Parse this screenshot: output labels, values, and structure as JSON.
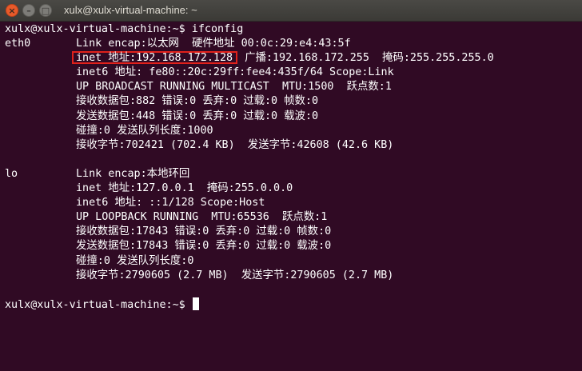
{
  "window": {
    "title": "xulx@xulx-virtual-machine: ~",
    "buttons": {
      "close": "×",
      "minimize": "–",
      "maximize": "□"
    }
  },
  "terminal": {
    "prompt1": "xulx@xulx-virtual-machine:~$ ifconfig",
    "eth0": {
      "name": "eth0",
      "l1": "Link encap:以太网  硬件地址 00:0c:29:e4:43:5f",
      "l2_inet": "inet 地址:192.168.172.128",
      "l2_rest": " 广播:192.168.172.255  掩码:255.255.255.0",
      "l3": "inet6 地址: fe80::20c:29ff:fee4:435f/64 Scope:Link",
      "l4": "UP BROADCAST RUNNING MULTICAST  MTU:1500  跃点数:1",
      "l5": "接收数据包:882 错误:0 丢弃:0 过载:0 帧数:0",
      "l6": "发送数据包:448 错误:0 丢弃:0 过载:0 载波:0",
      "l7": "碰撞:0 发送队列长度:1000",
      "l8": "接收字节:702421 (702.4 KB)  发送字节:42608 (42.6 KB)"
    },
    "lo": {
      "name": "lo",
      "l1": "Link encap:本地环回",
      "l2": "inet 地址:127.0.0.1  掩码:255.0.0.0",
      "l3": "inet6 地址: ::1/128 Scope:Host",
      "l4": "UP LOOPBACK RUNNING  MTU:65536  跃点数:1",
      "l5": "接收数据包:17843 错误:0 丢弃:0 过载:0 帧数:0",
      "l6": "发送数据包:17843 错误:0 丢弃:0 过载:0 载波:0",
      "l7": "碰撞:0 发送队列长度:0",
      "l8": "接收字节:2790605 (2.7 MB)  发送字节:2790605 (2.7 MB)"
    },
    "prompt2": "xulx@xulx-virtual-machine:~$ "
  },
  "colors": {
    "background": "#300a24",
    "text": "#ffffff",
    "highlight_box": "#e0211b",
    "close_button": "#e85a2a"
  }
}
